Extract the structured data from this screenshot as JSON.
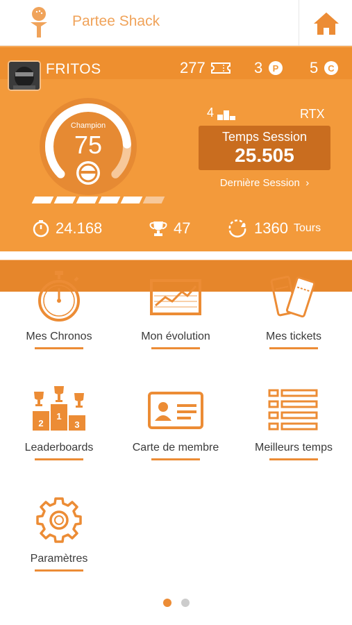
{
  "header": {
    "app_title": "Partee Shack",
    "logo_icon": "golf-tee-icon",
    "home_icon": "home-icon"
  },
  "profile": {
    "username": "FRITOS",
    "tickets": "277",
    "points": "3",
    "credits": "5",
    "level_title": "Champion",
    "level_value": "75",
    "level_progress_fraction": 0.82,
    "progress_segments_filled": 5,
    "progress_segments_total": 6,
    "rank": "4",
    "car": "RTX",
    "session_label": "Temps Session",
    "session_value": "25.505",
    "last_session_link": "Dernière Session",
    "best_time": "24.168",
    "trophies": "47",
    "laps": "1360",
    "laps_unit": "Tours"
  },
  "menu": [
    {
      "label": "Mes Chronos",
      "icon": "stopwatch-icon"
    },
    {
      "label": "Mon évolution",
      "icon": "chart-icon"
    },
    {
      "label": "Mes tickets",
      "icon": "tickets-icon"
    },
    {
      "label": "Leaderboards",
      "icon": "podium-icon"
    },
    {
      "label": "Carte de membre",
      "icon": "member-card-icon"
    },
    {
      "label": "Meilleurs temps",
      "icon": "list-icon"
    },
    {
      "label": "Paramètres",
      "icon": "gear-icon"
    }
  ],
  "pagination": {
    "current": 1,
    "total": 2
  },
  "colors": {
    "accent": "#f39a3b",
    "accent_dark": "#c96d1f",
    "text": "#3a3a3a"
  }
}
